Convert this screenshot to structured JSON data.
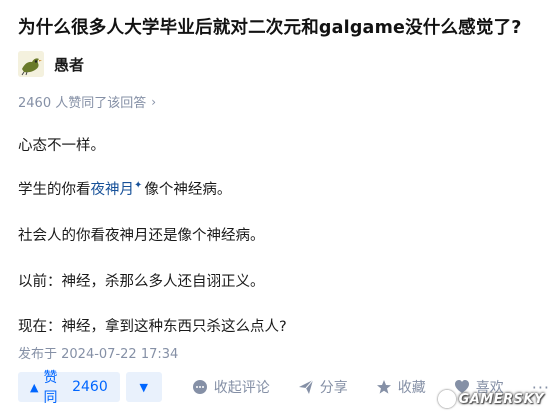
{
  "question": {
    "title": "为什么很多人大学毕业后就对二次元和galgame没什么感觉了?"
  },
  "author": {
    "name": "愚者",
    "avatar_icon": "bird-avatar-icon"
  },
  "answer": {
    "upvote_summary": "2460 人赞同了该回答",
    "paragraphs": {
      "p1": "心态不一样。",
      "p2_before": "学生的你看",
      "p2_link": "夜神月",
      "p2_after": "像个神经病。",
      "p3": "社会人的你看夜神月还是像个神经病。",
      "p4": "以前：神经，杀那么多人还自诩正义。",
      "p5": "现在：神经，拿到这种东西只杀这么点人?"
    },
    "publish_time": "发布于 2024-07-22 17:34"
  },
  "actions": {
    "upvote_label": "赞同",
    "upvote_count": "2460",
    "comment_label": "收起评论",
    "share_label": "分享",
    "favorite_label": "收藏",
    "like_label": "喜欢",
    "colors": {
      "accent": "#0066ff",
      "accent_bg": "#e9f1fc",
      "muted": "#8590a6",
      "link": "#175199"
    }
  },
  "watermark": {
    "text": "GAMERSKY"
  }
}
